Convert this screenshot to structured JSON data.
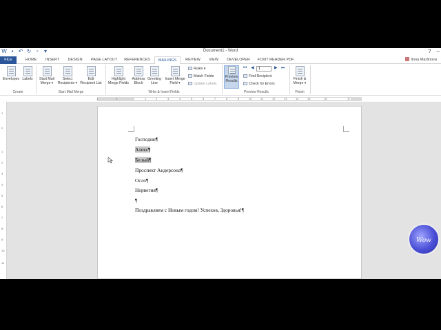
{
  "window": {
    "title": "Document1 - Word",
    "user": "Ilona Martinova"
  },
  "tabs": [
    "FILE",
    "HOME",
    "INSERT",
    "DESIGN",
    "PAGE LAYOUT",
    "REFERENCES",
    "MAILINGS",
    "REVIEW",
    "VIEW",
    "DEVELOPER",
    "FOXIT READER PDF"
  ],
  "active_tab": "MAILINGS",
  "ribbon": {
    "create": {
      "envelopes": "Envelopes",
      "labels": "Labels",
      "group": "Create"
    },
    "start": {
      "start_mail_merge": [
        "Start Mail",
        "Merge ▾"
      ],
      "select_recipients": [
        "Select",
        "Recipients ▾"
      ],
      "edit_recipient_list": [
        "Edit",
        "Recipient List"
      ],
      "group": "Start Mail Merge"
    },
    "write": {
      "highlight": [
        "Highlight",
        "Merge Fields"
      ],
      "address_block": [
        "Address",
        "Block"
      ],
      "greeting_line": [
        "Greeting",
        "Line"
      ],
      "insert_merge_field": [
        "Insert Merge",
        "Field ▾"
      ],
      "rules": "Rules ▾",
      "match_fields": "Match Fields",
      "update_labels": "Update Labels",
      "group": "Write & Insert Fields"
    },
    "preview": {
      "preview_results": [
        "Preview",
        "Results"
      ],
      "record": "1",
      "find_recipient": "Find Recipient",
      "check_errors": "Check for Errors",
      "group": "Preview Results"
    },
    "finish": {
      "finish_merge": [
        "Finish &",
        "Merge ▾"
      ],
      "group": "Finish"
    }
  },
  "ruler": {
    "labels": [
      "1",
      "2",
      "1",
      "2",
      "3",
      "4",
      "5",
      "6",
      "7",
      "8",
      "9",
      "10",
      "11",
      "12",
      "13",
      "14",
      "15",
      "16",
      "17"
    ]
  },
  "vruler": {
    "labels": [
      "1",
      "2",
      "1",
      "2",
      "3",
      "4",
      "5",
      "6",
      "7",
      "8",
      "9",
      "10",
      "11"
    ]
  },
  "document": {
    "lines": [
      {
        "text": "Господин¶",
        "field": false
      },
      {
        "text": "Алекс¶",
        "field": true
      },
      {
        "text": "Белый¶",
        "field": true
      },
      {
        "text": "Проспект Андерсона¶",
        "field": false
      },
      {
        "text": "Осло¶",
        "field": false
      },
      {
        "text": "Норвегия¶",
        "field": false
      },
      {
        "text": "¶",
        "field": false
      },
      {
        "text": "Поздравляем с Новым годом! Успехов, Здоровья!¶",
        "field": false
      }
    ]
  },
  "logo": {
    "text": "Wow"
  }
}
